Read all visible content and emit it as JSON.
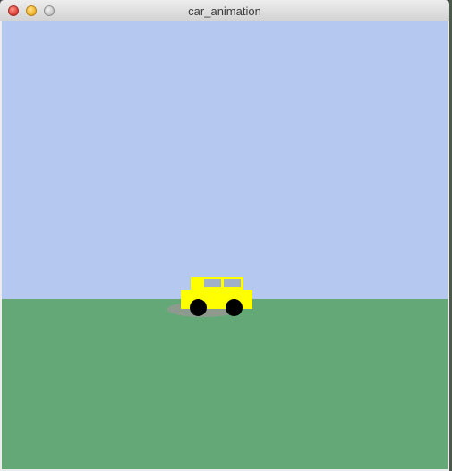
{
  "window": {
    "title": "car_animation",
    "controls": {
      "close_icon": "close-icon",
      "minimize_icon": "minimize-icon",
      "zoom_icon": "zoom-icon"
    }
  },
  "scene": {
    "sky_color": "#b5c8f0",
    "ground_color": "#64a878",
    "car": {
      "body_color": "#ffff00",
      "window_color": "#9fb0c8",
      "wheel_color": "#000000",
      "shadow_color": "#8d9b8f"
    }
  }
}
